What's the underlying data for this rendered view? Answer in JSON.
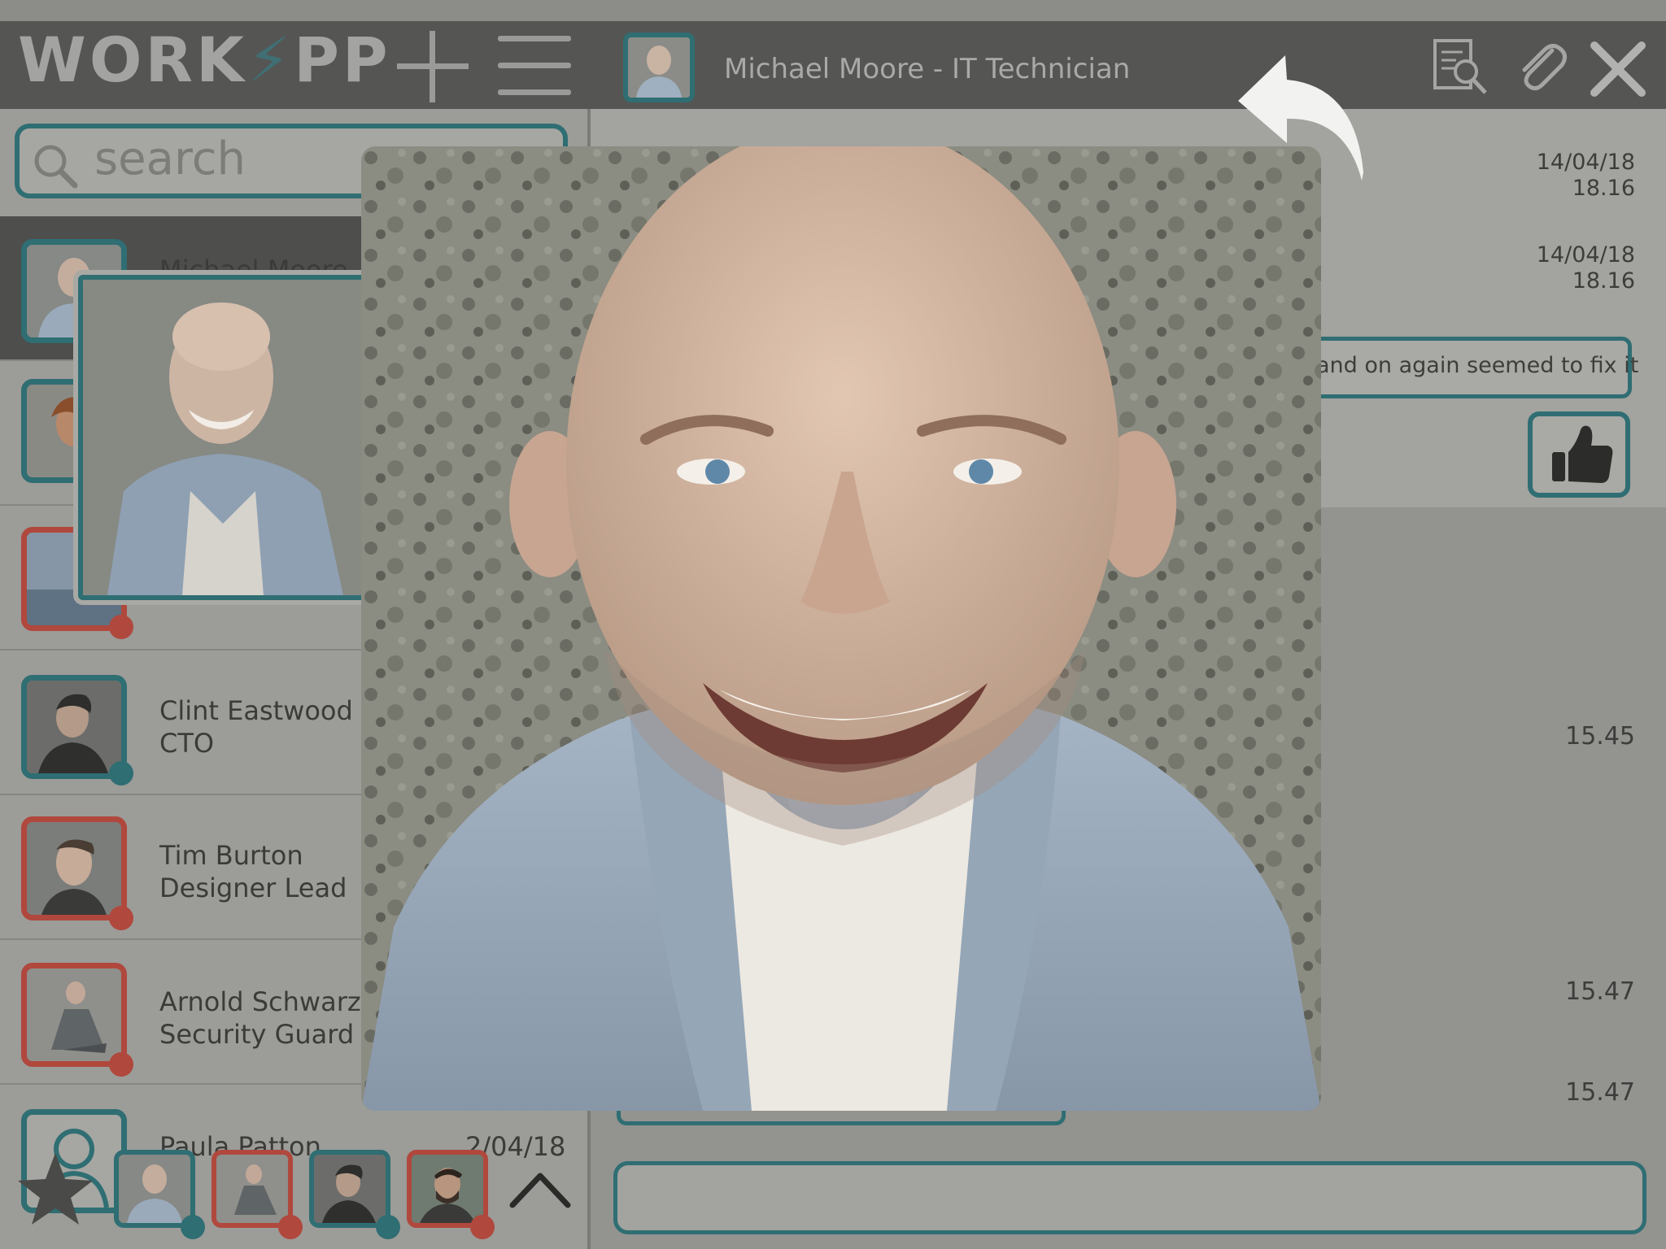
{
  "app": {
    "logo_text_a": "WORK",
    "logo_text_b": "PP",
    "brand_color": "#2f6e73",
    "alert_color": "#b0483d"
  },
  "header": {
    "title": "Michael Moore - IT Technician",
    "icons": [
      "add-icon",
      "menu-icon",
      "search-document-icon",
      "paperclip-icon",
      "close-icon"
    ]
  },
  "search": {
    "placeholder": "search"
  },
  "contacts": [
    {
      "name": "Michael Moore",
      "role": "",
      "status": "teal",
      "active": true
    },
    {
      "name": "",
      "role": "",
      "status": "teal"
    },
    {
      "name": "",
      "role": "",
      "status": "red"
    },
    {
      "name": "Clint Eastwood",
      "role": "CTO",
      "status": "teal"
    },
    {
      "name": "Tim Burton",
      "role": "Designer Lead",
      "status": "red"
    },
    {
      "name": "Arnold Schwarze",
      "role": "Security Guard",
      "status": "red"
    },
    {
      "name": "Paula Patton",
      "role": "",
      "date": "2/04/18",
      "status": "teal"
    }
  ],
  "chat": {
    "timestamps": [
      {
        "date": "14/04/18",
        "time": "18.16"
      },
      {
        "date": "14/04/18",
        "time": "18.16"
      },
      {
        "time": "15.45"
      },
      {
        "time": "15.47"
      },
      {
        "time": "15.47"
      }
    ],
    "message_partial": "and on again seemed to fix it",
    "reaction_icon": "thumbs-up-icon"
  },
  "bottom_bar": {
    "favorites_icon": "star-icon",
    "expand_icon": "chevron-up-icon"
  },
  "overlay": {
    "photo_subject": "profile-photo",
    "back_icon": "back-arrow-icon"
  }
}
